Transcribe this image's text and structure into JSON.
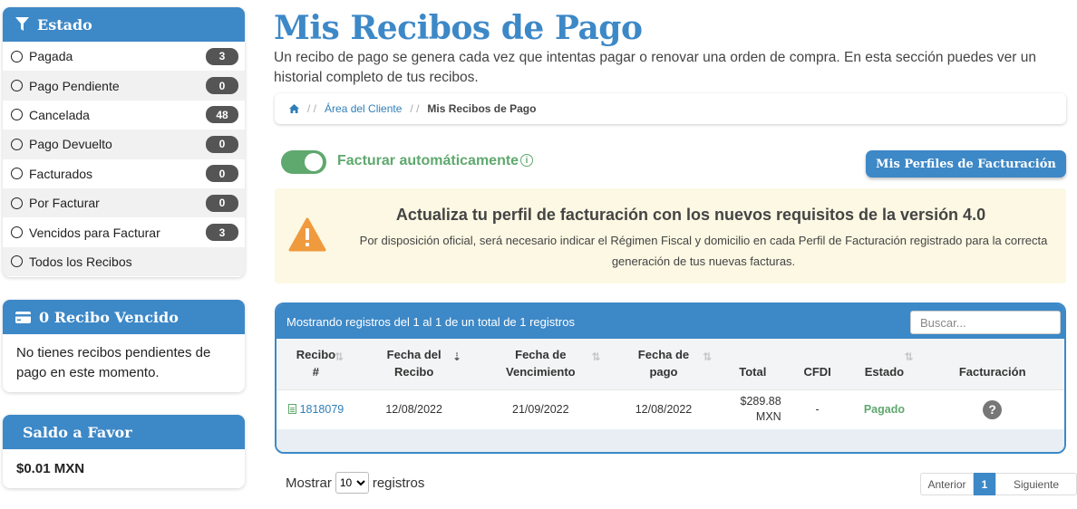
{
  "colors": {
    "brand": "#3d88c7",
    "success": "#5fa86e",
    "warning": "#f09a3e",
    "alert_bg": "#fcf8e3"
  },
  "sidebar": {
    "status_title": "Estado",
    "status_icon": "filter-icon",
    "statuses": [
      {
        "label": "Pagada",
        "count": "3"
      },
      {
        "label": "Pago Pendiente",
        "count": "0"
      },
      {
        "label": "Cancelada",
        "count": "48"
      },
      {
        "label": "Pago Devuelto",
        "count": "0"
      },
      {
        "label": "Facturados",
        "count": "0"
      },
      {
        "label": "Por Facturar",
        "count": "0"
      },
      {
        "label": "Vencidos para Facturar",
        "count": "3"
      },
      {
        "label": "Todos los Recibos",
        "count": ""
      }
    ],
    "vencido": {
      "title": "0 Recibo Vencido",
      "icon": "credit-card-icon",
      "text": "No tienes recibos pendientes de pago en este momento."
    },
    "saldo": {
      "title": "Saldo a Favor",
      "amount": "$0.01 MXN"
    }
  },
  "main": {
    "title": "Mis Recibos de Pago",
    "description": "Un recibo de pago se genera cada vez que intentas pagar o renovar una orden de compra. En esta sección puedes ver un historial completo de tus recibos.",
    "breadcrumb": {
      "home_icon": "home-icon",
      "separator": "/ /",
      "client_area": "Área del Cliente",
      "current": "Mis Recibos de Pago"
    },
    "autobill": {
      "label": "Facturar automáticamente",
      "enabled": true,
      "info_icon": "info-icon"
    },
    "profiles_button": "Mis Perfiles de Facturación",
    "alert": {
      "icon": "warning-icon",
      "title": "Actualiza tu perfil de facturación con los nuevos requisitos de la versión 4.0",
      "text": "Por disposición oficial, será necesario indicar el Régimen Fiscal y domicilio en cada Perfil de Facturación registrado para la correcta generación de tus nuevas facturas."
    },
    "table": {
      "info": "Mostrando registros del 1 al 1 de un total de 1 registros",
      "search_placeholder": "Buscar...",
      "headers": {
        "recibo": [
          "Recibo",
          "#"
        ],
        "fecha": [
          "Fecha del",
          "Recibo"
        ],
        "vencimiento": [
          "Fecha de",
          "Vencimiento"
        ],
        "pago": [
          "Fecha de",
          "pago"
        ],
        "total": "Total",
        "cfdi": "CFDI",
        "estado": "Estado",
        "facturacion": "Facturación"
      },
      "rows": [
        {
          "recibo": "1818079",
          "fecha": "12/08/2022",
          "vencimiento": "21/09/2022",
          "pago": "12/08/2022",
          "total_amount": "$289.88",
          "total_currency": "MXN",
          "cfdi": "-",
          "estado": "Pagado",
          "facturacion_icon": "help-icon"
        }
      ]
    },
    "footer": {
      "show_prefix": "Mostrar",
      "show_value": "10",
      "show_suffix": "registros",
      "pager": {
        "prev": "Anterior",
        "current": "1",
        "next": "Siguiente"
      }
    }
  }
}
